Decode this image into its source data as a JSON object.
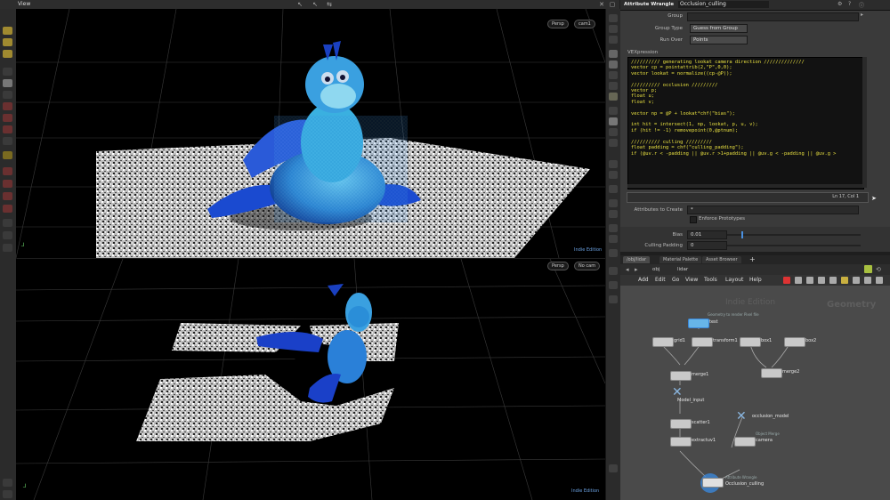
{
  "view_pane": {
    "title": "View",
    "top_viewport": {
      "camera_mode": "Persp",
      "camera": "cam1",
      "edition": "Indie Edition"
    },
    "bottom_viewport": {
      "camera_mode": "Persp",
      "camera": "No cam",
      "edition": "Indie Edition"
    }
  },
  "parameter_pane": {
    "node_type": "Attribute Wrangle",
    "node_name": "Occlusion_culling",
    "group_label": "Group",
    "group_type_label": "Group Type",
    "group_type_value": "Guess from Group",
    "run_over_label": "Run Over",
    "run_over_value": "Points",
    "vexpression_label": "VEXpression",
    "code_lines": [
      "////////// generating lookat camera direction //////////////",
      "vector cp = pointattrib(2,\"P\",0,0);",
      "vector lookat = normalize((cp-@P));",
      "",
      "////////// occlusion /////////",
      "vector p;",
      "float u;",
      "float v;",
      "",
      "vector np = @P + lookat*chf(\"bias\");",
      "",
      "int hit = intersect(1, np, lookat, p, u, v);",
      "if (hit != -1) removepoint(0,@ptnum);",
      "",
      "////////// culling /////////",
      "float padding = chf(\"culling_padding\");",
      "if (@uv.r < -padding || @uv.r >1+padding || @uv.g < -padding || @uv.g >"
    ],
    "status_line": "Ln 17, Col 1",
    "attributes_to_create_label": "Attributes to Create",
    "attributes_to_create_value": "*",
    "enforce_prototypes_label": "Enforce Prototypes",
    "bias_label": "Bias",
    "bias_value": "0.01",
    "culling_padding_label": "Culling Padding",
    "culling_padding_value": "0"
  },
  "network_pane": {
    "tabs": [
      "/obj/lidar",
      "Material Palette",
      "Asset Browser"
    ],
    "path_obj": "obj",
    "path_node": "lidar",
    "menu": [
      "Add",
      "Edit",
      "Go",
      "View",
      "Tools",
      "Layout",
      "Help"
    ],
    "watermark_left": "Indie Edition",
    "watermark_right": "Geometry",
    "nodes": [
      {
        "name": "test",
        "sub": "Geometry to render Pixel file"
      },
      {
        "name": "grid1",
        "sub": ""
      },
      {
        "name": "transform1",
        "sub": ""
      },
      {
        "name": "box1",
        "sub": ""
      },
      {
        "name": "box2",
        "sub": ""
      },
      {
        "name": "merge1",
        "sub": ""
      },
      {
        "name": "merge2",
        "sub": ""
      },
      {
        "name": "Model_input",
        "sub": ""
      },
      {
        "name": "scatter1",
        "sub": ""
      },
      {
        "name": "occlusion_model",
        "sub": ""
      },
      {
        "name": "extractuv1",
        "sub": ""
      },
      {
        "name": "camera",
        "sub": "Object Merge"
      },
      {
        "name": "Occlusion_culling",
        "sub": "Attribute Wrangle"
      }
    ]
  },
  "colors": {
    "accent": "#3a86d8",
    "code_text": "#e8e040",
    "viewport_bg": "#000000"
  }
}
